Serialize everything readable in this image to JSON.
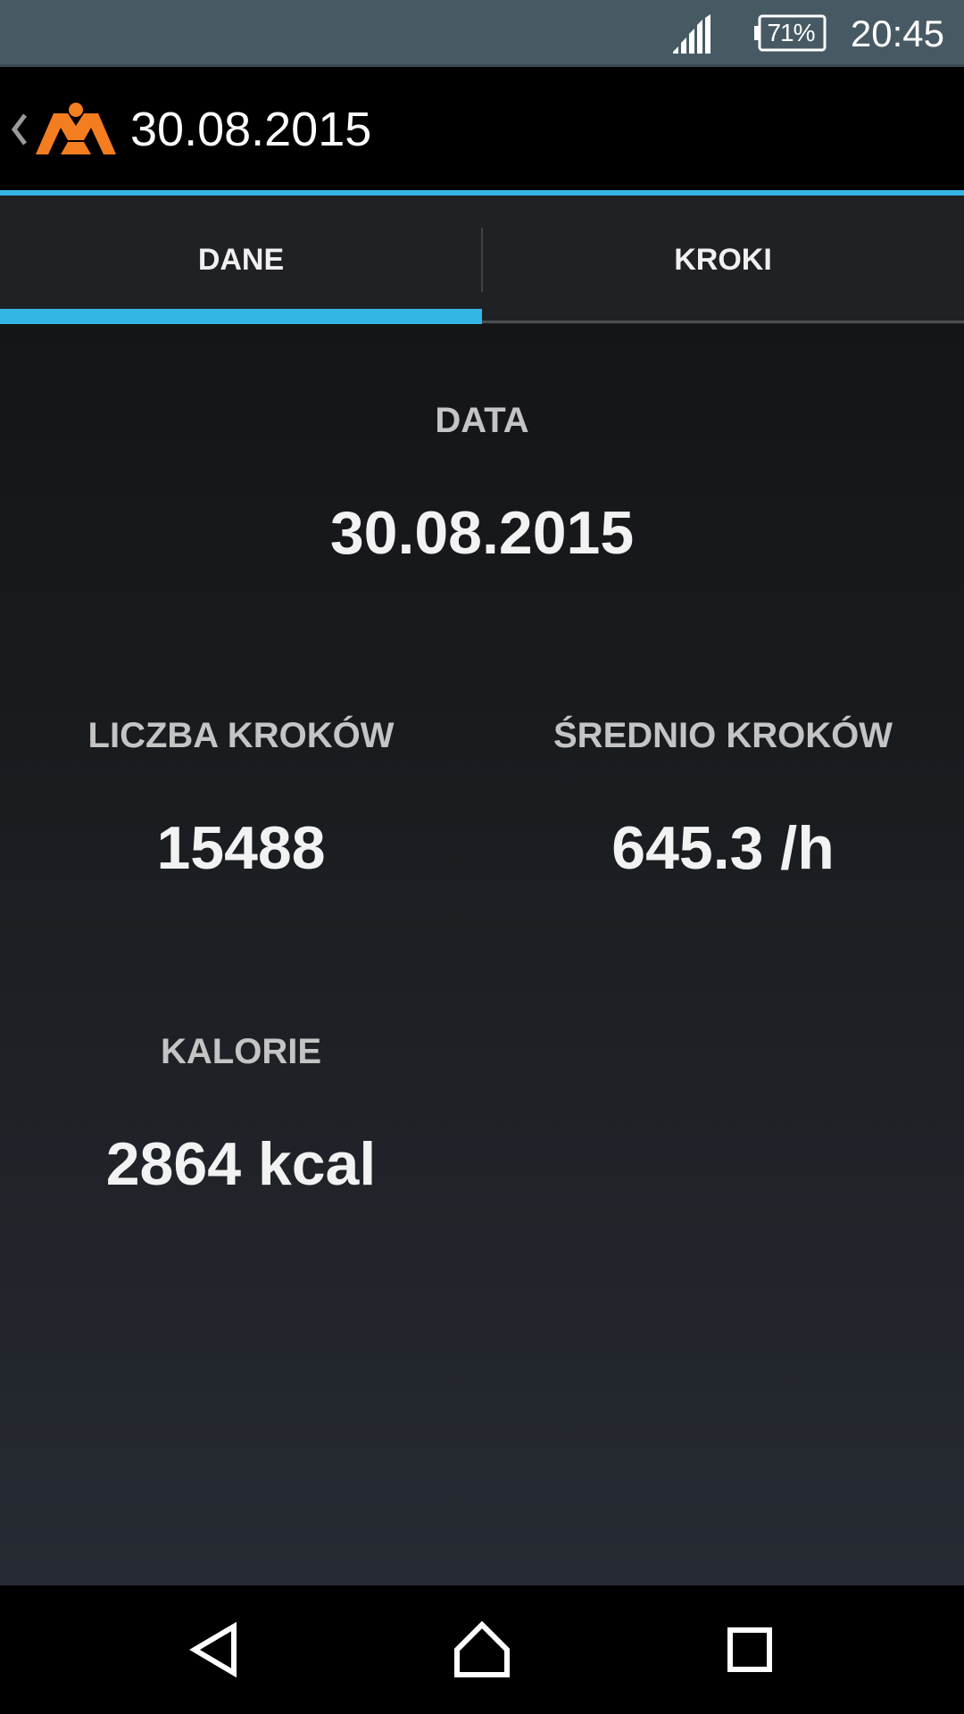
{
  "status_bar": {
    "battery": "71%",
    "time": "20:45",
    "icons": [
      "signal-icon",
      "battery-icon"
    ]
  },
  "action_bar": {
    "title": "30.08.2015",
    "back_icon": "chevron-left-icon",
    "logo": "app-logo",
    "accent_color": "#33b5e5",
    "logo_color": "#f47d20"
  },
  "tabs": [
    {
      "label": "DANE",
      "selected": true
    },
    {
      "label": "KROKI",
      "selected": false
    }
  ],
  "stats": {
    "date": {
      "label": "DATA",
      "value": "30.08.2015"
    },
    "steps": {
      "label": "LICZBA KROKÓW",
      "value": "15488"
    },
    "avg_steps": {
      "label": "ŚREDNIO KROKÓW",
      "value": "645.3 /h"
    },
    "calories": {
      "label": "KALORIE",
      "value": "2864 kcal"
    }
  },
  "nav_bar": {
    "icons": [
      "back-triangle-icon",
      "home-icon",
      "recents-icon"
    ]
  }
}
